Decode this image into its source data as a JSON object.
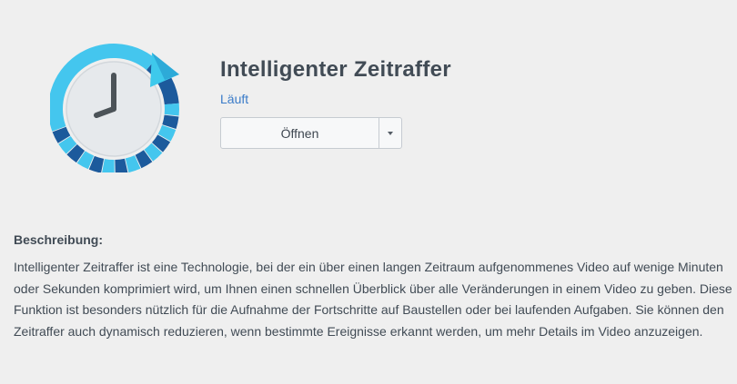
{
  "app": {
    "title": "Intelligenter Zeitraffer",
    "status": "Läuft",
    "icon": "time-lapse-clock-icon"
  },
  "actions": {
    "open_label": "Öffnen",
    "dropdown_icon": "caret-down-icon"
  },
  "description": {
    "heading": "Beschreibung:",
    "text": "Intelligenter Zeitraffer ist eine Technologie, bei der ein über einen langen Zeitraum aufgenommenes Video auf wenige Minuten oder Sekunden komprimiert wird, um Ihnen einen schnellen Überblick über alle Veränderungen in einem Video zu geben. Diese Funktion ist besonders nützlich für die Aufnahme der Fortschritte auf Baustellen oder bei laufenden Aufgaben. Sie können den Zeitraffer auch dynamisch reduzieren, wenn bestimmte Ereignisse erkannt werden, um mehr Details im Video anzuzeigen."
  },
  "colors": {
    "background": "#efefef",
    "title": "#414b55",
    "status": "#3a7bc8",
    "icon_ring_light": "#44c6ee",
    "icon_ring_dark": "#1c5a9c",
    "icon_face": "#e6e9ec"
  }
}
